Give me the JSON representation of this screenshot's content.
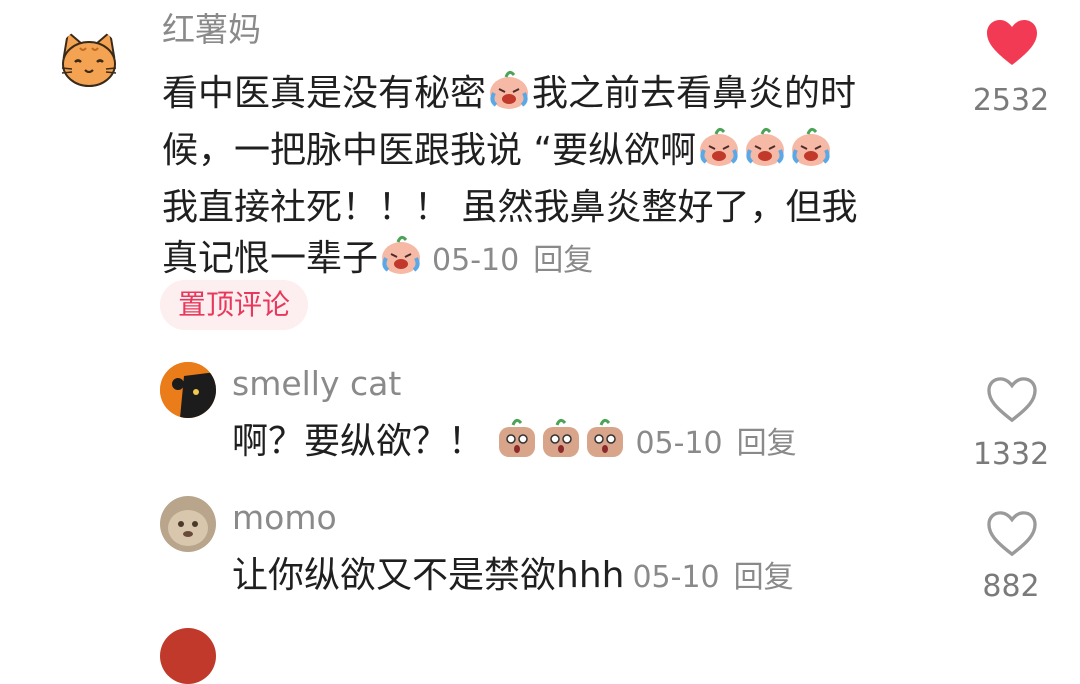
{
  "main_comment": {
    "username": "红薯妈",
    "text_lines": [
      "看中医真是没有秘密",
      "我之前去看鼻炎的时候，一把脉中医跟我说 “要纵欲啊",
      "我直接社死！！！ 虽然我鼻炎整好了，但我真记恨一辈子"
    ],
    "line1_a": "看中医真是没有秘密",
    "line1_b": "我之前去看鼻炎的时",
    "line2": "候，一把脉中医跟我说 “要纵欲啊",
    "line3": "我直接社死！！！ 虽然我鼻炎整好了，但我",
    "line4": "真记恨一辈子",
    "date": "05-10",
    "reply_label": "回复",
    "badge": "置顶评论",
    "likes": "2532",
    "liked": true
  },
  "replies": [
    {
      "username": "smelly cat",
      "text": "啊？要纵欲？！",
      "date": "05-10",
      "reply_label": "回复",
      "likes": "1332"
    },
    {
      "username": "momo",
      "text": "让你纵欲又不是禁欲hhh",
      "date": "05-10",
      "reply_label": "回复",
      "likes": "882"
    }
  ],
  "colors": {
    "accent_red": "#f23a54",
    "badge_bg": "#fdeef0",
    "muted": "#8a8a8a"
  },
  "icons": [
    "cat-avatar-icon",
    "heart-filled-icon",
    "heart-outline-icon",
    "crying-laugh-emoji",
    "shocked-emoji"
  ]
}
